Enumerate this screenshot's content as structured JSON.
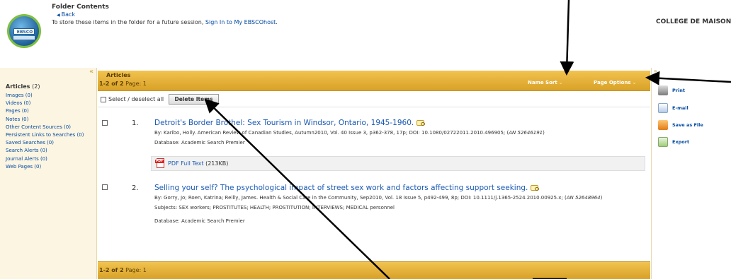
{
  "header": {
    "logo_text": "EBSCO",
    "title": "Folder Contents",
    "back_label": "Back",
    "store_prefix": "To store these items in the folder for a future session, ",
    "store_link": "Sign In to My EBSCOhost",
    "store_suffix": ".",
    "institution": "COLLEGE DE MAISONNEUVE"
  },
  "left_panel": {
    "collapse_glyph": "«",
    "items": [
      {
        "label": "Articles",
        "count": "(2)",
        "active": true
      },
      {
        "label": "Images (0)"
      },
      {
        "label": "Videos (0)"
      },
      {
        "label": "Pages (0)"
      },
      {
        "label": "Notes (0)"
      },
      {
        "label": "Other Content Sources (0)"
      },
      {
        "label": "Persistent Links to Searches (0)"
      },
      {
        "label": "Saved Searches (0)"
      },
      {
        "label": "Search Alerts (0)"
      },
      {
        "label": "Journal Alerts (0)"
      },
      {
        "label": "Web Pages (0)"
      }
    ]
  },
  "main": {
    "section_title": "Articles",
    "range": "1-2 of 2",
    "page_label": "Page: 1",
    "sort_label": "Name Sort",
    "options_label": "Page Options",
    "select_all_label": "Select / deselect all",
    "delete_label": "Delete Items",
    "results": [
      {
        "num": "1.",
        "title": "Detroit's Border Brothel: Sex Tourism in Windsor, Ontario, 1945-1960.",
        "byline": "By: Karibo, Holly. American Review of Canadian Studies, Autumn2010, Vol. 40 Issue 3, p362-378, 17p; DOI: 10.1080/02722011.2010.496905; (",
        "an": "AN 52646191",
        "byline_end": ")",
        "database": "Database: Academic Search Premier",
        "pdf_label": "PDF Full Text",
        "pdf_size": "(213KB)"
      },
      {
        "num": "2.",
        "title": "Selling your self? The psychological impact of street sex work and factors affecting support seeking.",
        "byline": "By: Gorry, Jo; Roen, Katrina; Reilly, James. Health & Social Care in the Community, Sep2010, Vol. 18 Issue 5, p492-499, 8p; DOI: 10.1111/j.1365-2524.2010.00925.x; (",
        "an": "AN 52648964",
        "byline_end": ")",
        "subjects": "Subjects: SEX workers; PROSTITUTES; HEALTH; PROSTITUTION; INTERVIEWS; MEDICAL personnel",
        "database": "Database: Academic Search Premier"
      }
    ]
  },
  "right_panel": {
    "collapse_glyph": "»",
    "tools": [
      {
        "label": "Print",
        "icon": "printer-icon"
      },
      {
        "label": "E-mail",
        "icon": "email-icon"
      },
      {
        "label": "Save as File",
        "icon": "save-file-icon"
      },
      {
        "label": "Export",
        "icon": "export-icon"
      }
    ]
  }
}
